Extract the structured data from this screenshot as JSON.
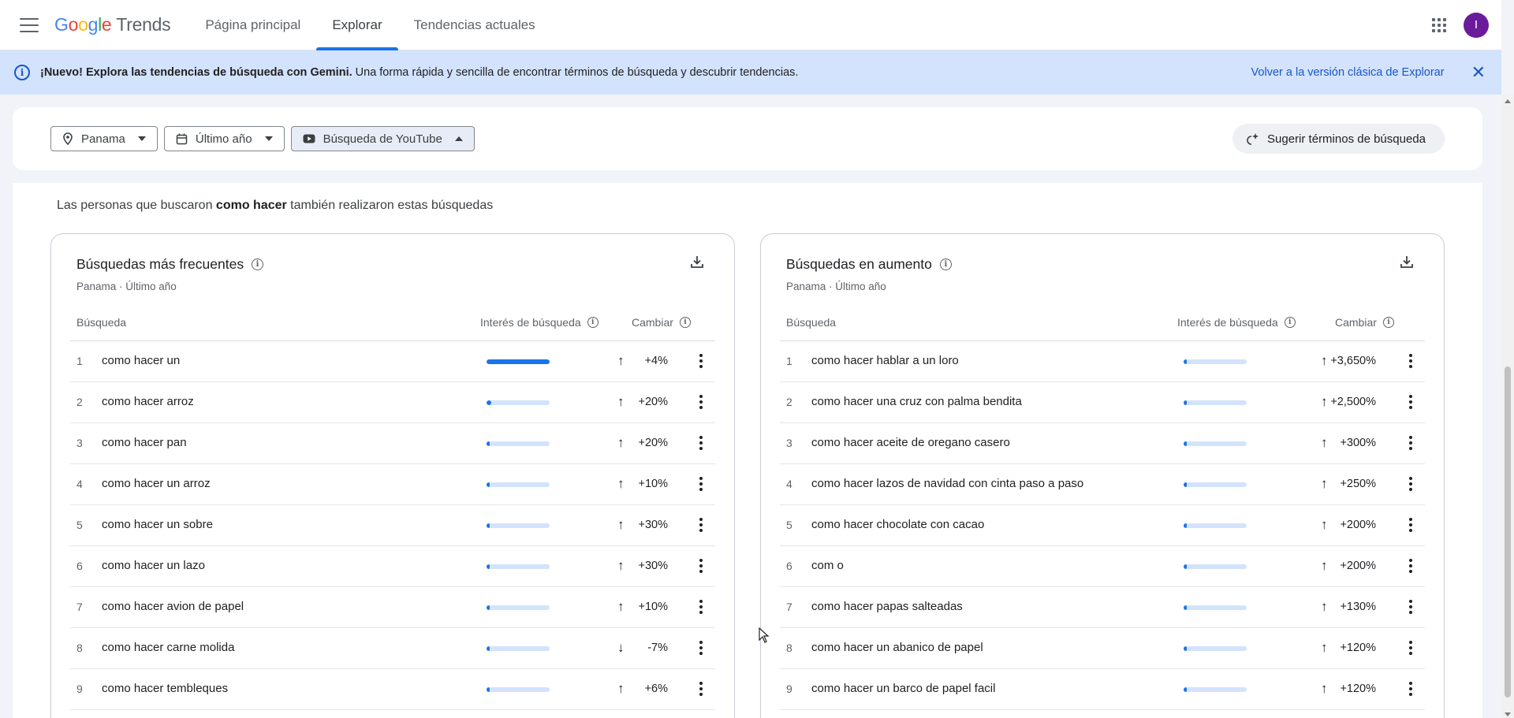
{
  "header": {
    "logo_text": "Google",
    "logo_suffix": "Trends",
    "tabs": [
      {
        "label": "Página principal"
      },
      {
        "label": "Explorar"
      },
      {
        "label": "Tendencias actuales"
      }
    ],
    "avatar_initial": "I"
  },
  "banner": {
    "bold_text": "¡Nuevo! Explora las tendencias de búsqueda con Gemini.",
    "text": " Una forma rápida y sencilla de encontrar términos de búsqueda y descubrir tendencias.",
    "link": "Volver a la versión clásica de Explorar",
    "close_label": "✕"
  },
  "filters": {
    "location": "Panama",
    "time": "Último año",
    "property": "Búsqueda de YouTube",
    "suggest": "Sugerir términos de búsqueda"
  },
  "related": {
    "prefix": "Las personas que buscaron ",
    "term": "como hacer",
    "suffix": " también realizaron estas búsquedas"
  },
  "top_queries": {
    "title": "Búsquedas más frecuentes",
    "subtitle": "Panama · Último año",
    "col_query": "Búsqueda",
    "col_interest": "Interés de búsqueda",
    "col_change": "Cambiar",
    "rows": [
      {
        "rank": "1",
        "term": "como hacer un",
        "interest": 1.0,
        "direction": "up",
        "change": "+4%"
      },
      {
        "rank": "2",
        "term": "como hacer arroz",
        "interest": 0.08,
        "direction": "up",
        "change": "+20%"
      },
      {
        "rank": "3",
        "term": "como hacer pan",
        "interest": 0.04,
        "direction": "up",
        "change": "+20%"
      },
      {
        "rank": "4",
        "term": "como hacer un arroz",
        "interest": 0.03,
        "direction": "up",
        "change": "+10%"
      },
      {
        "rank": "5",
        "term": "como hacer un sobre",
        "interest": 0.03,
        "direction": "up",
        "change": "+30%"
      },
      {
        "rank": "6",
        "term": "como hacer un lazo",
        "interest": 0.03,
        "direction": "up",
        "change": "+30%"
      },
      {
        "rank": "7",
        "term": "como hacer avion de papel",
        "interest": 0.03,
        "direction": "up",
        "change": "+10%"
      },
      {
        "rank": "8",
        "term": "como hacer carne molida",
        "interest": 0.03,
        "direction": "down",
        "change": "-7%"
      },
      {
        "rank": "9",
        "term": "como hacer tembleques",
        "interest": 0.03,
        "direction": "up",
        "change": "+6%"
      }
    ]
  },
  "rising_queries": {
    "title": "Búsquedas en aumento",
    "subtitle": "Panama · Último año",
    "col_query": "Búsqueda",
    "col_interest": "Interés de búsqueda",
    "col_change": "Cambiar",
    "rows": [
      {
        "rank": "1",
        "term": "como hacer hablar a un loro",
        "interest": 0.02,
        "direction": "up",
        "change": "+3,650%"
      },
      {
        "rank": "2",
        "term": "como hacer una cruz con palma bendita",
        "interest": 0.02,
        "direction": "up",
        "change": "+2,500%"
      },
      {
        "rank": "3",
        "term": "como hacer aceite de oregano casero",
        "interest": 0.02,
        "direction": "up",
        "change": "+300%"
      },
      {
        "rank": "4",
        "term": "como hacer lazos de navidad con cinta paso a paso",
        "interest": 0.02,
        "direction": "up",
        "change": "+250%"
      },
      {
        "rank": "5",
        "term": "como hacer chocolate con cacao",
        "interest": 0.02,
        "direction": "up",
        "change": "+200%"
      },
      {
        "rank": "6",
        "term": "com o",
        "interest": 0.02,
        "direction": "up",
        "change": "+200%"
      },
      {
        "rank": "7",
        "term": "como hacer papas salteadas",
        "interest": 0.02,
        "direction": "up",
        "change": "+130%"
      },
      {
        "rank": "8",
        "term": "como hacer un abanico de papel",
        "interest": 0.02,
        "direction": "up",
        "change": "+120%"
      },
      {
        "rank": "9",
        "term": "como hacer un barco de papel facil",
        "interest": 0.02,
        "direction": "up",
        "change": "+120%"
      }
    ]
  },
  "colors": {
    "accent": "#1a73e8",
    "banner_bg": "#d3e3fd",
    "bar_track": "#d3e3fd"
  },
  "icons": {
    "menu": "menu-icon",
    "apps": "apps-grid-icon",
    "info": "info-icon",
    "close": "close-icon",
    "location": "location-pin-icon",
    "calendar": "calendar-icon",
    "youtube": "youtube-icon",
    "suggest": "sparkle-icon",
    "download": "download-icon",
    "more": "more-vertical-icon",
    "arrow_up": "arrow-up-icon",
    "arrow_down": "arrow-down-icon"
  }
}
